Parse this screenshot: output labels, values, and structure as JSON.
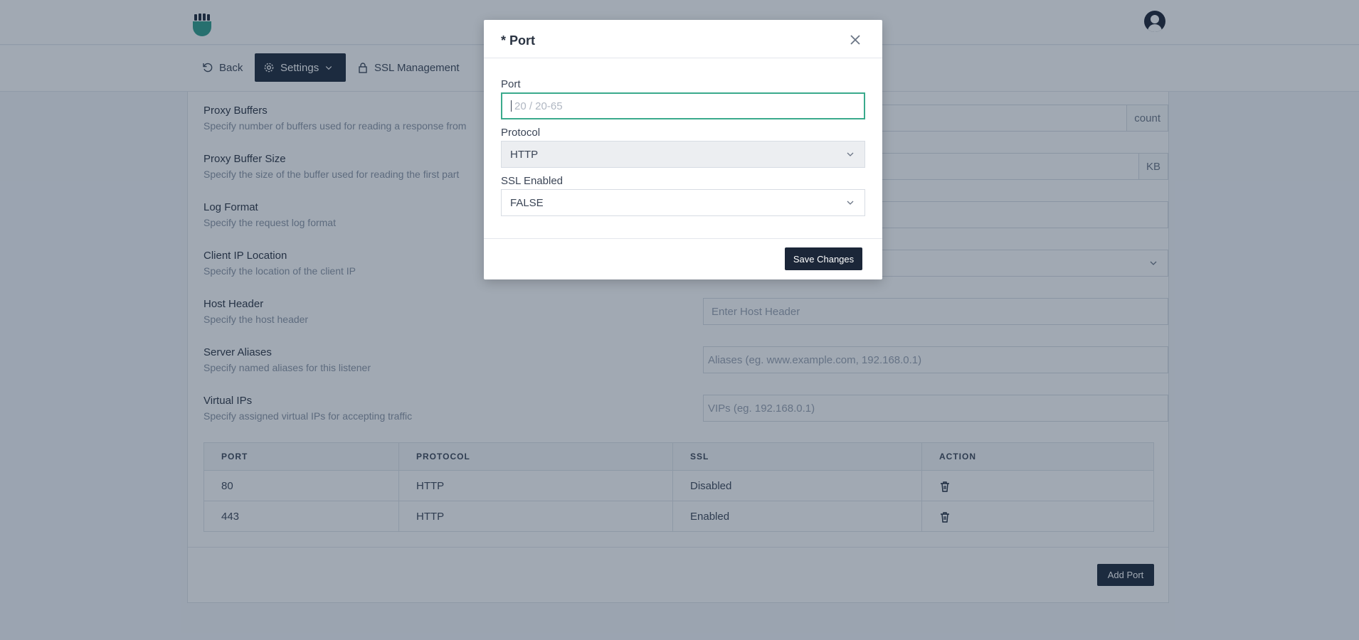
{
  "header": {
    "logo_icon": "fist-logo-icon",
    "avatar_icon": "user-avatar-icon"
  },
  "nav": {
    "back": "Back",
    "settings": "Settings",
    "ssl": "SSL Management"
  },
  "settings": [
    {
      "label": "Proxy Buffers",
      "desc": "Specify number of buffers used for reading a response from",
      "value": "",
      "suffix": "count"
    },
    {
      "label": "Proxy Buffer Size",
      "desc": "Specify the size of the buffer used for reading the first part",
      "value": "",
      "suffix": "KB"
    },
    {
      "label": "Log Format",
      "desc": "Specify the request log format",
      "value": ""
    },
    {
      "label": "Client IP Location",
      "desc": "Specify the location of the client IP",
      "value": ""
    },
    {
      "label": "Host Header",
      "desc": "Specify the host header",
      "placeholder": "Enter Host Header"
    },
    {
      "label": "Server Aliases",
      "desc": "Specify named aliases for this listener",
      "placeholder": "Aliases (eg. www.example.com, 192.168.0.1)"
    },
    {
      "label": "Virtual IPs",
      "desc": "Specify assigned virtual IPs for accepting traffic",
      "placeholder": "VIPs (eg. 192.168.0.1)"
    }
  ],
  "ports_table": {
    "headers": [
      "PORT",
      "PROTOCOL",
      "SSL",
      "ACTION"
    ],
    "rows": [
      {
        "port": "80",
        "protocol": "HTTP",
        "ssl": "Disabled"
      },
      {
        "port": "443",
        "protocol": "HTTP",
        "ssl": "Enabled"
      }
    ]
  },
  "add_port": "Add Port",
  "modal": {
    "title": "* Port",
    "port_label": "Port",
    "port_placeholder": "20 / 20-65",
    "protocol_label": "Protocol",
    "protocol_value": "HTTP",
    "ssl_label": "SSL Enabled",
    "ssl_value": "FALSE",
    "save": "Save Changes"
  },
  "colors": {
    "primary_dark": "#1b2638",
    "accent_green": "#3aaa8c",
    "overlay": "rgba(30,50,75,0.42)"
  }
}
